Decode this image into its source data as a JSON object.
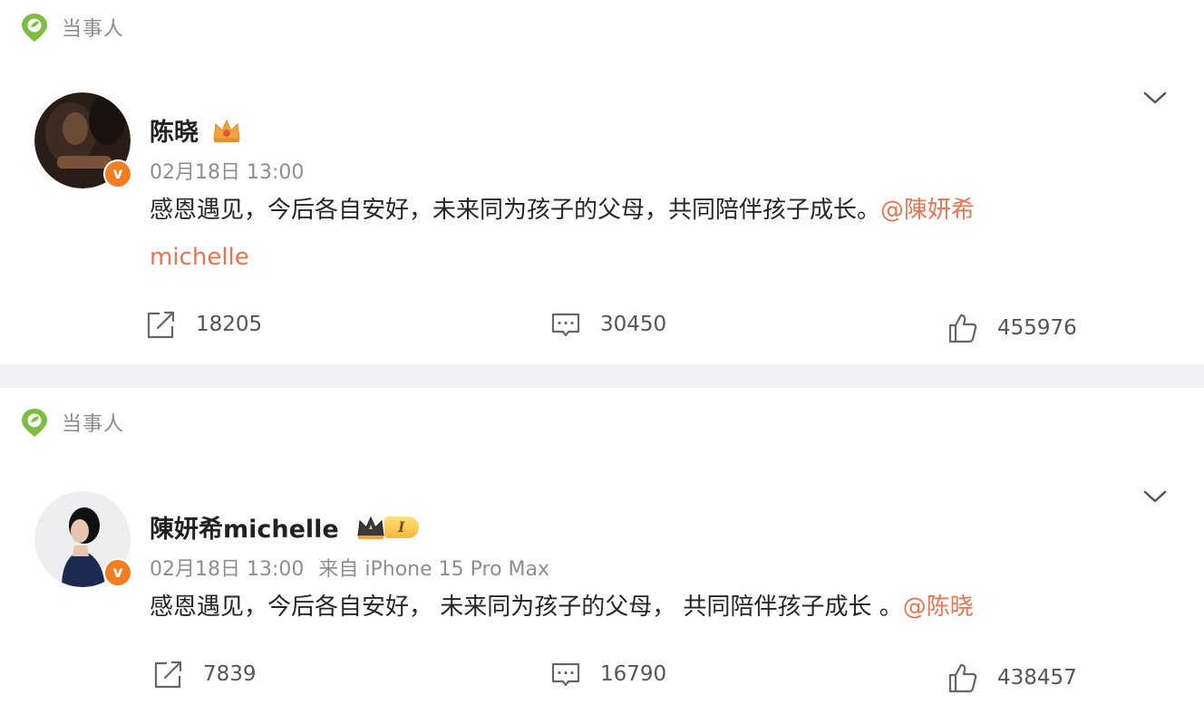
{
  "posts": [
    {
      "tag_label": "当事人",
      "username": "陈晓",
      "time": "02月18日 13:00",
      "source": "",
      "content_text": "感恩遇见，今后各自安好，未来同为孩子的父母，共同陪伴孩子成长。",
      "mention_line1": "@陳妍希",
      "mention_line2": "michelle",
      "verified_mark": "v",
      "reposts": "18205",
      "comments": "30450",
      "likes": "455976"
    },
    {
      "tag_label": "当事人",
      "username": "陳妍希michelle",
      "time": "02月18日 13:00",
      "source": "来自 iPhone 15 Pro Max",
      "content_text": "感恩遇见，今后各自安好， 未来同为孩子的父母， 共同陪伴孩子成长 。",
      "mention": "@陈晓",
      "verified_mark": "v",
      "badge_text": "I",
      "reposts": "7839",
      "comments": "16790",
      "likes": "438457"
    }
  ],
  "colors": {
    "mention": "#eb7350",
    "verified": "#f57c1f",
    "tag_icon": "#7dbd3f",
    "crown": "#f2a33a"
  },
  "icons": [
    "location-pin-icon",
    "chevron-down-icon",
    "crown-icon",
    "repost-icon",
    "comment-icon",
    "like-icon"
  ]
}
